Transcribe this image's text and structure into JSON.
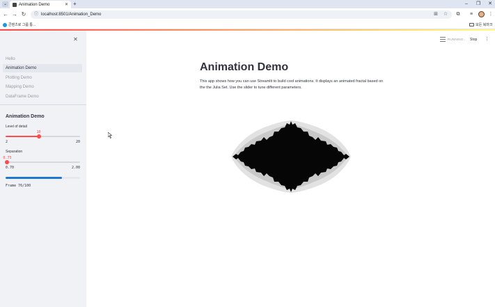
{
  "browser": {
    "tab_title": "Animation Demo",
    "url": "localhost:8501/Animation_Demo",
    "bookmark_label": "콘텐츠로 그룹 통...",
    "bookmark_folder_label": "모든 북마크"
  },
  "sidebar": {
    "nav": [
      {
        "label": "Hello",
        "active": false
      },
      {
        "label": "Animation Demo",
        "active": true
      },
      {
        "label": "Plotting Demo",
        "active": false
      },
      {
        "label": "Mapping Demo",
        "active": false
      },
      {
        "label": "DataFrame Demo",
        "active": false
      }
    ],
    "section_title": "Animation Demo",
    "level_slider": {
      "label": "Level of detail",
      "value": "10",
      "min": "2",
      "max": "20",
      "value_fraction": 0.444
    },
    "separation_slider": {
      "label": "Separation",
      "value": "0.73",
      "min": "0.70",
      "max": "2.00",
      "value_fraction": 0.023
    },
    "progress_fraction": 0.76,
    "frame_text": "Frame 76/100"
  },
  "header": {
    "status_text": "RUNNING...",
    "stop_label": "Stop"
  },
  "main": {
    "title": "Animation Demo",
    "description": "This app shows how you can use Streamlit to build cool animations. It displays an animated fractal based on the the Julia Set. Use the slider to tune different parameters."
  },
  "colors": {
    "accent": "#ff4b4b",
    "progress": "#1f77d0",
    "sidebar_bg": "#f0f2f6"
  }
}
